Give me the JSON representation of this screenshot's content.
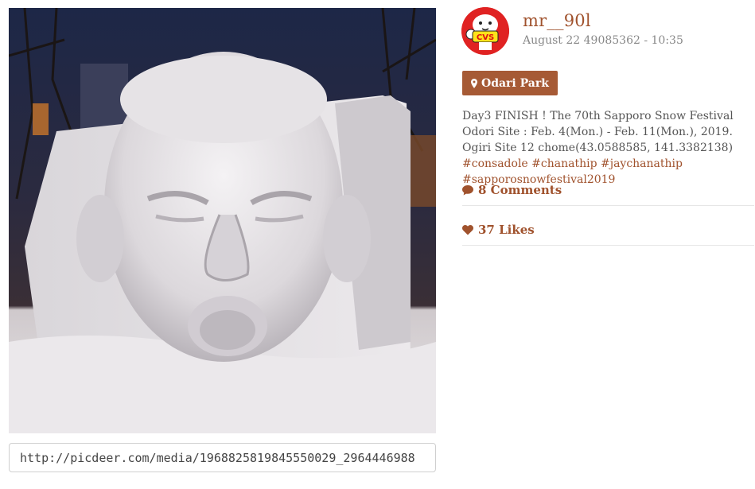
{
  "post": {
    "image_alt": "Snow sculpture of a face at the Sapporo Snow Festival",
    "media_url": "http://picdeer.com/media/1968825819845550029_2964446988"
  },
  "user": {
    "username": "mr__90l",
    "avatar_text": "CVS",
    "timestamp": "August 22 49085362 - 10:35"
  },
  "location": {
    "label": "Odari Park"
  },
  "caption": {
    "text": "Day3 FINISH ! The 70th Sapporo Snow Festival Odori Site : Feb. 4(Mon.) - Feb. 11(Mon.), 2019. Ogiri Site 12 chome(43.0588585, 141.3382138) ",
    "tags": [
      "#consadole",
      "#chanathip",
      "#jaychanathip",
      "#sapporosnowfestival2019"
    ]
  },
  "stats": {
    "comments": "8 Comments",
    "likes": "37 Likes"
  },
  "colors": {
    "accent": "#a0522d",
    "location_bg": "#a65a35"
  },
  "icons": {
    "location": "map-marker-icon",
    "comments": "comment-icon",
    "likes": "heart-icon"
  }
}
